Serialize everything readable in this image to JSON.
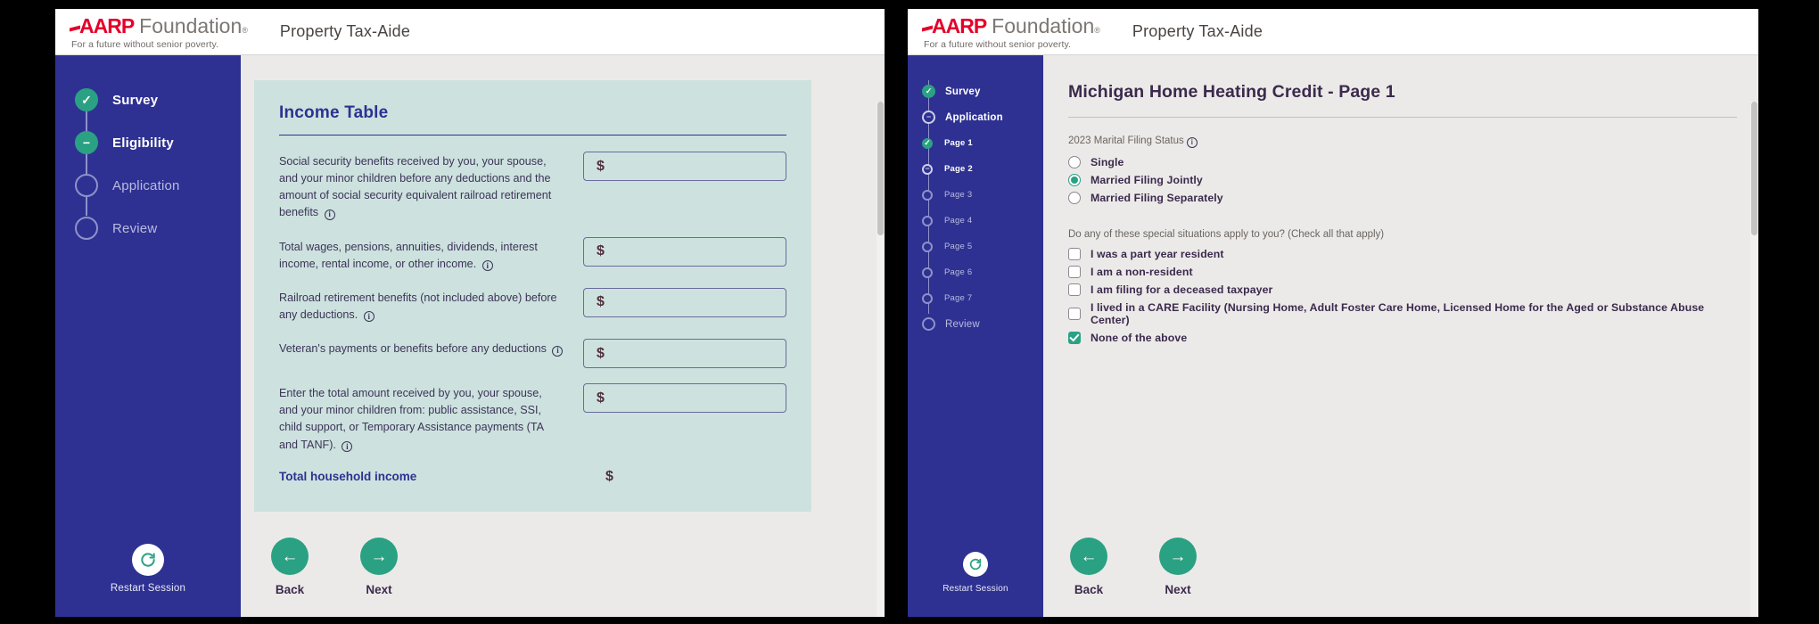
{
  "brand": {
    "name_bold": "AARP",
    "name_light": "Foundation",
    "tagline": "For a future without senior poverty.",
    "app_title": "Property Tax-Aide",
    "accent_red": "#e4002b",
    "accent_teal": "#2aa183",
    "accent_navy": "#2e3192"
  },
  "left": {
    "sidebar": {
      "steps": [
        {
          "label": "Survey",
          "state": "done",
          "glyph": "✓"
        },
        {
          "label": "Eligibility",
          "state": "current",
          "glyph": "−"
        },
        {
          "label": "Application",
          "state": "pending",
          "glyph": ""
        },
        {
          "label": "Review",
          "state": "pending",
          "glyph": ""
        }
      ],
      "restart_label": "Restart Session",
      "restart_icon": "restart-icon"
    },
    "card": {
      "title": "Income Table",
      "rows": [
        {
          "question": "Social security benefits received by you, your spouse, and your minor children before any deductions and the amount of social security equivalent railroad retirement benefits",
          "info": true,
          "value": "$"
        },
        {
          "question": "Total wages, pensions, annuities, dividends, interest income, rental income, or other income.",
          "info": true,
          "value": "$"
        },
        {
          "question": "Railroad retirement benefits (not included above) before any deductions.",
          "info": true,
          "value": "$"
        },
        {
          "question": "Veteran's payments or benefits before any deductions",
          "info": true,
          "value": "$"
        },
        {
          "question": "Enter the total amount received by you, your spouse, and your minor children from: public assistance, SSI, child support, or Temporary Assistance payments (TA and TANF).",
          "info": true,
          "value": "$"
        }
      ],
      "total_label": "Total household income",
      "total_value": "$"
    },
    "footer": {
      "back_label": "Back",
      "back_icon": "arrow-left-icon",
      "next_label": "Next",
      "next_icon": "arrow-right-icon"
    }
  },
  "right": {
    "sidebar": {
      "steps": [
        {
          "label": "Survey",
          "state": "done",
          "glyph": "✓",
          "sub": false
        },
        {
          "label": "Application",
          "state": "current",
          "glyph": "−",
          "sub": false
        },
        {
          "label": "Page 1",
          "state": "done",
          "glyph": "✓",
          "sub": true
        },
        {
          "label": "Page 2",
          "state": "active",
          "glyph": "−",
          "sub": true
        },
        {
          "label": "Page 3",
          "state": "pending",
          "glyph": "",
          "sub": true
        },
        {
          "label": "Page 4",
          "state": "pending",
          "glyph": "",
          "sub": true
        },
        {
          "label": "Page 5",
          "state": "pending",
          "glyph": "",
          "sub": true
        },
        {
          "label": "Page 6",
          "state": "pending",
          "glyph": "",
          "sub": true
        },
        {
          "label": "Page 7",
          "state": "pending",
          "glyph": "",
          "sub": true
        },
        {
          "label": "Review",
          "state": "pending",
          "glyph": "",
          "sub": false
        }
      ],
      "restart_label": "Restart Session",
      "restart_icon": "restart-icon"
    },
    "form": {
      "title": "Michigan Home Heating Credit - Page 1",
      "filing_status_label": "2023 Marital Filing Status",
      "filing_status_options": [
        {
          "label": "Single",
          "selected": false
        },
        {
          "label": "Married Filing Jointly",
          "selected": true
        },
        {
          "label": "Married Filing Separately",
          "selected": false
        }
      ],
      "special_label": "Do any of these special situations apply to you? (Check all that apply)",
      "special_options": [
        {
          "label": "I was a part year resident",
          "checked": false
        },
        {
          "label": "I am a non-resident",
          "checked": false
        },
        {
          "label": "I am filing for a deceased taxpayer",
          "checked": false
        },
        {
          "label": "I lived in a CARE Facility (Nursing Home, Adult Foster Care Home, Licensed Home for the Aged or Substance Abuse Center)",
          "checked": false
        },
        {
          "label": "None of the above",
          "checked": true
        }
      ]
    },
    "footer": {
      "back_label": "Back",
      "back_icon": "arrow-left-icon",
      "next_label": "Next",
      "next_icon": "arrow-right-icon"
    }
  }
}
